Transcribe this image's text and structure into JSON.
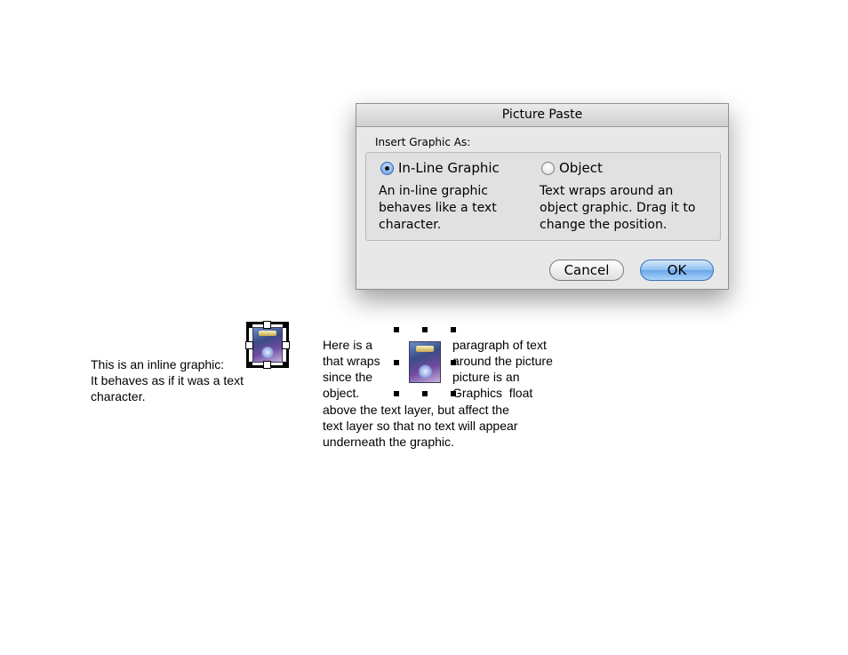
{
  "dialog": {
    "title": "Picture Paste",
    "group_label": "Insert Graphic As:",
    "options": [
      {
        "label": "In-Line Graphic",
        "selected": true,
        "description": "An in-line graphic\nbehaves like a text\ncharacter."
      },
      {
        "label": "Object",
        "selected": false,
        "description": "Text wraps around an\nobject graphic. Drag it to\nchange the position."
      }
    ],
    "buttons": {
      "cancel": "Cancel",
      "ok": "OK"
    }
  },
  "document": {
    "inline_paragraph": "This is an inline graphic:\nIt behaves as if it was a text\ncharacter.",
    "wrap_left_lines": "Here is a\nthat wraps\nsince the\nobject.",
    "wrap_right_lines": "paragraph of text\naround the picture\npicture is an\nGraphics  float",
    "wrap_bottom_lines": "above the text layer, but affect the\ntext layer so that no text will appear\nunderneath the graphic."
  },
  "colors": {
    "accent": "#5f9ae4",
    "dialog_bg": "#e8e8e8"
  }
}
